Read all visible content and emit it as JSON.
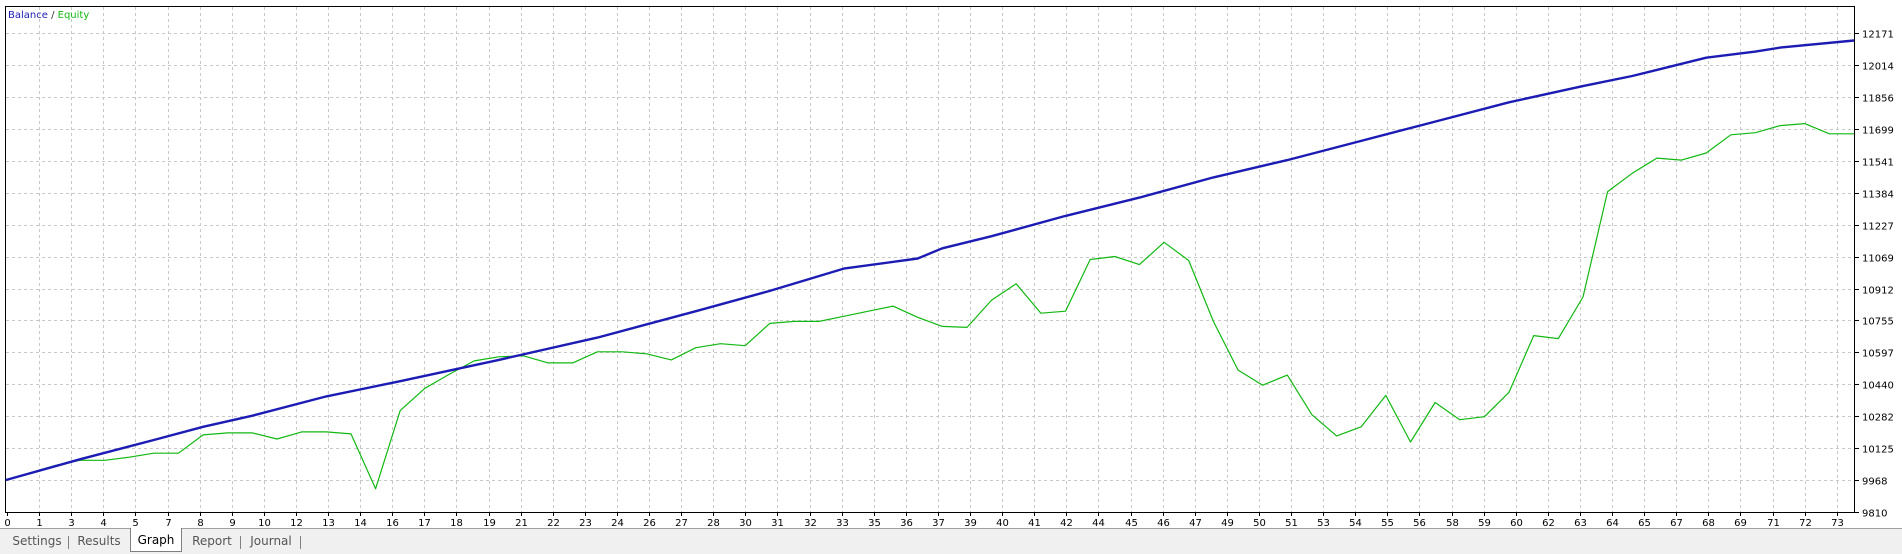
{
  "legend": {
    "balance_label": "Balance",
    "separator": " / ",
    "equity_label": "Equity",
    "balance_color": "#1c1cb4",
    "equity_color": "#11b811"
  },
  "tabs": [
    {
      "label": "Settings",
      "active": false
    },
    {
      "label": "Results",
      "active": false
    },
    {
      "label": "Graph",
      "active": true
    },
    {
      "label": "Report",
      "active": false
    },
    {
      "label": "Journal",
      "active": false
    }
  ],
  "chart_data": {
    "type": "line",
    "title": "",
    "xlabel": "",
    "ylabel": "",
    "grid": true,
    "legend_position": "top-left",
    "ylim": [
      9810,
      12300
    ],
    "y_ticks": [
      9810,
      9968,
      10125,
      10282,
      10440,
      10597,
      10755,
      10912,
      11069,
      11227,
      11384,
      11541,
      11699,
      11856,
      12014,
      12171
    ],
    "x_ticks": [
      "0",
      "1",
      "3",
      "4",
      "5",
      "7",
      "8",
      "9",
      "10",
      "12",
      "13",
      "14",
      "16",
      "17",
      "18",
      "19",
      "21",
      "22",
      "23",
      "24",
      "26",
      "27",
      "28",
      "30",
      "31",
      "32",
      "33",
      "35",
      "36",
      "37",
      "39",
      "40",
      "41",
      "42",
      "44",
      "45",
      "46",
      "47",
      "49",
      "50",
      "51",
      "53",
      "54",
      "55",
      "56",
      "58",
      "59",
      "60",
      "62",
      "63",
      "64",
      "65",
      "67",
      "68",
      "69",
      "71",
      "72",
      "73"
    ],
    "x_range": [
      0,
      75
    ],
    "series": [
      {
        "name": "Balance",
        "color": "#1c1cb4",
        "x": [
          0,
          3,
          6,
          8,
          10,
          13,
          16,
          20,
          24,
          28,
          31,
          34,
          37,
          38,
          40,
          43,
          46,
          49,
          52,
          55,
          58,
          61,
          64,
          66,
          69,
          71,
          72,
          75
        ],
        "values": [
          9968,
          10070,
          10165,
          10230,
          10285,
          10380,
          10455,
          10560,
          10670,
          10800,
          10900,
          11010,
          11060,
          11110,
          11170,
          11270,
          11360,
          11460,
          11545,
          11640,
          11735,
          11830,
          11910,
          11960,
          12050,
          12080,
          12100,
          12135
        ]
      },
      {
        "name": "Equity",
        "color": "#11b811",
        "x": [
          0,
          2,
          3,
          4,
          5,
          6,
          7,
          8,
          9,
          10,
          11,
          12,
          13,
          14,
          15,
          16,
          17,
          18,
          19,
          20,
          21,
          22,
          23,
          24,
          25,
          26,
          27,
          28,
          29,
          30,
          31,
          32,
          33,
          34,
          35,
          36,
          37,
          38,
          39,
          40,
          41,
          42,
          43,
          44,
          45,
          46,
          47,
          48,
          49,
          50,
          51,
          52,
          53,
          54,
          55,
          56,
          57,
          58,
          59,
          60,
          61,
          62,
          63,
          64,
          65,
          66,
          67,
          68,
          69,
          70,
          71,
          72,
          73,
          74,
          75
        ],
        "values": [
          9968,
          10040,
          10065,
          10065,
          10080,
          10100,
          10100,
          10190,
          10200,
          10200,
          10170,
          10205,
          10205,
          10195,
          9925,
          10310,
          10420,
          10490,
          10555,
          10575,
          10580,
          10545,
          10545,
          10600,
          10600,
          10590,
          10560,
          10620,
          10640,
          10630,
          10740,
          10750,
          10750,
          10775,
          10800,
          10825,
          10770,
          10725,
          10720,
          10855,
          10935,
          10790,
          10800,
          11055,
          11070,
          11030,
          11140,
          11050,
          10750,
          10510,
          10435,
          10485,
          10290,
          10185,
          10230,
          10385,
          10155,
          10350,
          10265,
          10280,
          10400,
          10680,
          10665,
          10870,
          11390,
          11480,
          11555,
          11545,
          11580,
          11670,
          11680,
          11715,
          11725,
          11675,
          11675
        ]
      }
    ]
  }
}
